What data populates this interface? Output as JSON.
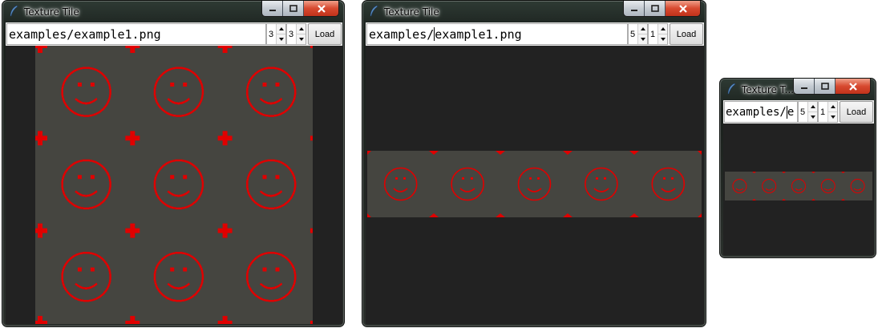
{
  "app": {
    "icon": "feather-icon",
    "colors": {
      "canvas_bg": "#222222",
      "tile_bg": "#454540",
      "tile_fg": "#e00000"
    }
  },
  "windows": [
    {
      "title": "Texture Tile",
      "path": "examples/example1.png",
      "cols": "3",
      "rows": "3",
      "load_label": "Load"
    },
    {
      "title": "Texture Tile",
      "path_before_cursor": "examples/",
      "path_after_cursor": "example1.png",
      "cols": "5",
      "rows": "1",
      "load_label": "Load"
    },
    {
      "title": "Texture T...",
      "path_before_cursor": "examples/",
      "path_after_cursor": "e",
      "cols": "5",
      "rows": "1",
      "load_label": "Load"
    }
  ],
  "window_controls": {
    "minimize": "minimize-icon",
    "maximize": "maximize-icon",
    "close": "close-icon"
  }
}
